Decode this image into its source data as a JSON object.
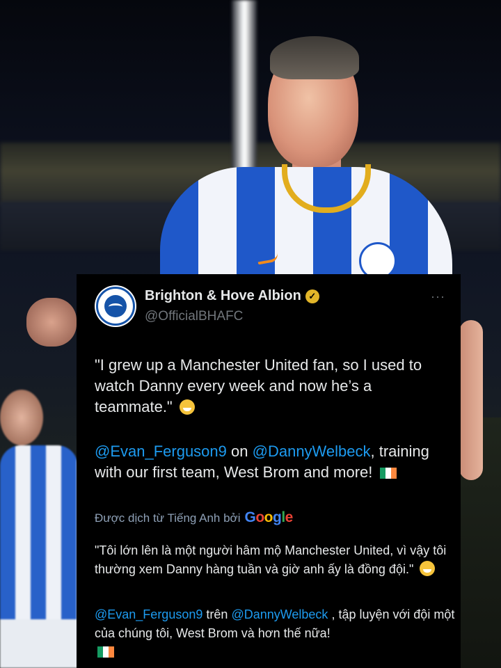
{
  "tweet": {
    "author_name": "Brighton & Hove Albion",
    "handle": "@OfficialBHAFC",
    "verified_glyph": "✓",
    "more_glyph": "···",
    "quote_text": "\"I grew up a Manchester United fan, so I used to watch Danny every week and now he’s a teammate.\"",
    "mention_1": "@Evan_Ferguson9",
    "word_on": "on",
    "mention_2": "@DannyWelbeck",
    "rest_text": ", training with our first team, West Brom and more!"
  },
  "translation": {
    "label": "Được dịch từ Tiếng Anh bởi",
    "google_letters": [
      "G",
      "o",
      "o",
      "g",
      "l",
      "e"
    ],
    "quote_text": "\"Tôi lớn lên là một người hâm mộ Manchester United, vì vậy tôi thường xem Danny hàng tuần và giờ anh ấy là đồng đội.\"",
    "mention_1": "@Evan_Ferguson9",
    "word_on": "trên",
    "mention_2": "@DannyWelbeck",
    "rest_text": " , tập luyện với đội một của chúng tôi, West Brom và hơn thế nữa!"
  },
  "colors": {
    "background": "#000000",
    "text": "#e7e9ea",
    "muted": "#71767b",
    "link": "#1d9bf0",
    "verified_badge": "#e2b529"
  },
  "icons": {
    "verified": "verified-badge-icon",
    "more": "more-options-icon",
    "emoji": "star-struck-emoji-icon",
    "flag": "ireland-flag-icon"
  }
}
